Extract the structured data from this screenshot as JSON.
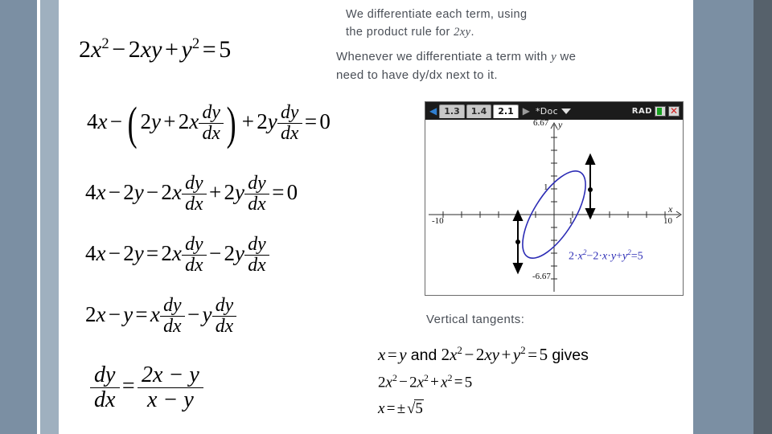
{
  "slide": {
    "background": "#ffffff",
    "band_colors": {
      "left_dark": "#7b8fa3",
      "left_light": "#9fb0bf",
      "right_mid": "#7b8fa3",
      "right_dark": "#56616b"
    }
  },
  "notes": {
    "top_line_1": "We differentiate each term, using",
    "top_line_2_a": "the product rule for ",
    "top_line_2_math": "2xy",
    "top_line_2_b": ".",
    "second_line_1_a": "Whenever we differentiate a term with ",
    "second_line_1_math": "y",
    "second_line_1_b": " we",
    "second_line_2": "need to have dy/dx next to it."
  },
  "equations": {
    "e0": "2x² − 2xy + y² = 5",
    "e1": "4x − (2y + 2x dy/dx) + 2y dy/dx = 0",
    "e2": "4x − 2y − 2x dy/dx + 2y dy/dx = 0",
    "e3": "4x − 2y = 2x dy/dx − 2y dy/dx",
    "e4": "2x − y = x dy/dx − y dy/dx",
    "e5": "dy/dx = (2x − y)/(x − y)",
    "numerals": {
      "two": "2",
      "four": "4",
      "five": "5",
      "zero": "0"
    },
    "vars": {
      "x": "x",
      "y": "y",
      "d": "d"
    },
    "ops": {
      "minus": "−",
      "plus": "+",
      "equals": "="
    },
    "exponent_two": "2"
  },
  "vertical_tangents": {
    "heading": "Vertical tangents:",
    "line1_pre": "x = y",
    "line1_and": "and",
    "line1_eq": "2x² − 2xy + y² = 5",
    "line1_post": "gives",
    "line2": "2x² − 2x² + x² = 5",
    "line3": "x = ±√5",
    "pm": "±",
    "radical": "√",
    "radicand": "5"
  },
  "calculator": {
    "tabs": [
      {
        "label": "1.3",
        "active": false
      },
      {
        "label": "1.4",
        "active": false
      },
      {
        "label": "2.1",
        "active": true
      }
    ],
    "nav_left_icon": "triangle-left-icon",
    "nav_right_icon": "triangle-right-icon",
    "doc_label": "*Doc",
    "doc_caret_icon": "chevron-down-icon",
    "angle_mode": "RAD",
    "battery_icon": "battery-icon",
    "close_icon": "close-icon",
    "cursor_icon": "mouse-pointer-icon",
    "graph": {
      "equation_label": "2·x²−2·x·y+y²=5",
      "equation_color": "#2b2bb5",
      "x_axis_label": "x",
      "y_axis_label": "y",
      "x_min_label": "-10",
      "x_max_label": "10",
      "y_max_label": "6.67",
      "y_min_label": "-6.67",
      "x_unit_label": "1",
      "y_unit_label": "1",
      "tangent_points": 2,
      "tangent_arrow_icon": "double-arrow-vertical-icon"
    }
  },
  "chart_data": {
    "type": "scatter",
    "title": "2·x²−2·x·y+y²=5",
    "xlabel": "x",
    "ylabel": "y",
    "xlim": [
      -10,
      10
    ],
    "ylim": [
      -6.67,
      6.67
    ],
    "grid": false,
    "curve": "tilted ellipse 2x^2-2xy+y^2=5",
    "tangent_points": [
      {
        "x": 2.236,
        "y": 2.236
      },
      {
        "x": -2.236,
        "y": -2.236
      }
    ],
    "annotations": [
      "vertical tangent arrows at x = ±√5"
    ]
  }
}
